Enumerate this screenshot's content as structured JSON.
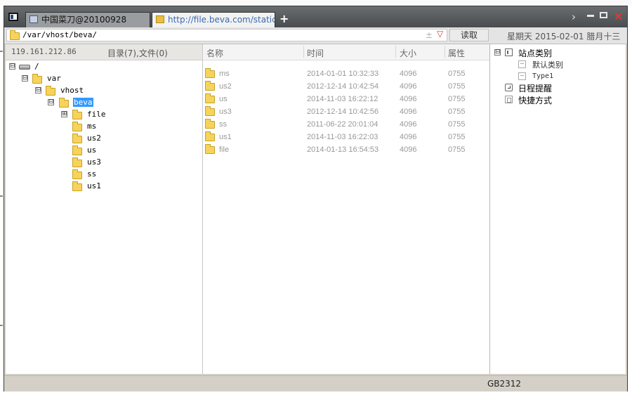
{
  "window": {
    "tabs": [
      {
        "label": "中国菜刀@20100928",
        "active": false
      },
      {
        "label": "http://file.beva.com/static/up...",
        "active": true
      }
    ],
    "new_tab": "+",
    "controls": {
      "next": "›",
      "close": "✕"
    }
  },
  "address": {
    "path": "/var/vhost/beva/",
    "read_label": "读取",
    "date": "星期天 2015-02-01 腊月十三"
  },
  "left_panel": {
    "ip": "119.161.212.86",
    "count": "目录(7),文件(0)",
    "tree": [
      {
        "label": "/",
        "expander": "⊟",
        "icon": "drive"
      },
      {
        "label": "var",
        "expander": "⊟",
        "icon": "folder"
      },
      {
        "label": "vhost",
        "expander": "⊟",
        "icon": "folder"
      },
      {
        "label": "beva",
        "expander": "⊟",
        "icon": "folder",
        "selected": true
      },
      {
        "label": "file",
        "expander": "⊞",
        "icon": "folder"
      },
      {
        "label": "ms",
        "expander": "",
        "icon": "folder"
      },
      {
        "label": "us2",
        "expander": "",
        "icon": "folder"
      },
      {
        "label": "us",
        "expander": "",
        "icon": "folder"
      },
      {
        "label": "us3",
        "expander": "",
        "icon": "folder"
      },
      {
        "label": "ss",
        "expander": "",
        "icon": "folder"
      },
      {
        "label": "us1",
        "expander": "",
        "icon": "folder"
      }
    ]
  },
  "file_list": {
    "columns": [
      "名称",
      "时间",
      "大小",
      "属性"
    ],
    "rows": [
      {
        "name": "ms",
        "time": "2014-01-01 10:32:33",
        "size": "4096",
        "attr": "0755"
      },
      {
        "name": "us2",
        "time": "2012-12-14 10:42:54",
        "size": "4096",
        "attr": "0755"
      },
      {
        "name": "us",
        "time": "2014-11-03 16:22:12",
        "size": "4096",
        "attr": "0755"
      },
      {
        "name": "us3",
        "time": "2012-12-14 10:42:56",
        "size": "4096",
        "attr": "0755"
      },
      {
        "name": "ss",
        "time": "2011-06-22 20:01:04",
        "size": "4096",
        "attr": "0755"
      },
      {
        "name": "us1",
        "time": "2014-11-03 16:22:03",
        "size": "4096",
        "attr": "0755"
      },
      {
        "name": "file",
        "time": "2014-01-13 16:54:53",
        "size": "4096",
        "attr": "0755"
      }
    ]
  },
  "right_panel": {
    "items": [
      {
        "label": "站点类别",
        "icon": "category-icon",
        "expander": "⊟"
      },
      {
        "label": "默认类别",
        "icon": "page-icon"
      },
      {
        "label": "Type1",
        "icon": "page-icon"
      },
      {
        "label": "日程提醒",
        "icon": "clock-icon"
      },
      {
        "label": "快捷方式",
        "icon": "shortcut-icon"
      }
    ]
  },
  "status": {
    "encoding": "GB2312"
  }
}
